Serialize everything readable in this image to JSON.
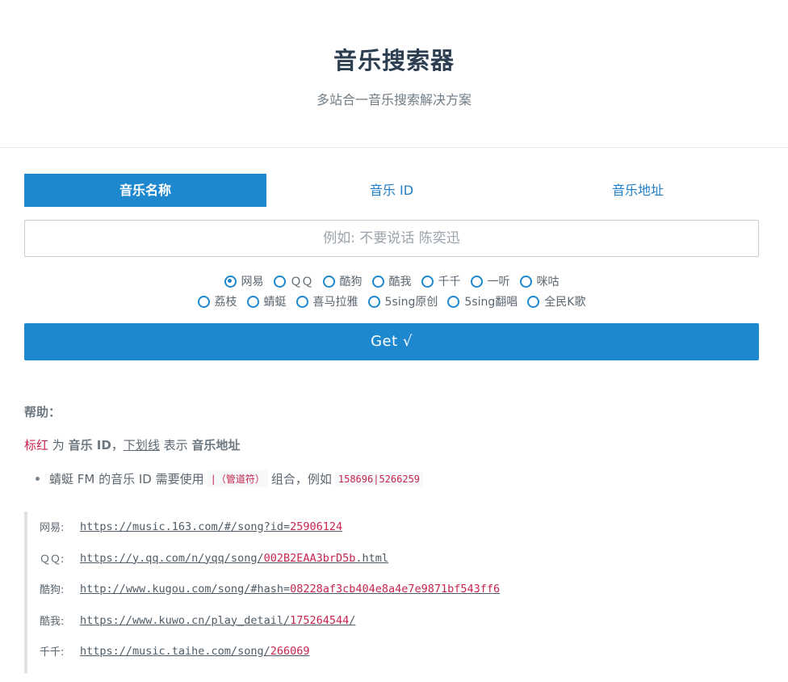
{
  "header": {
    "title": "音乐搜索器",
    "subtitle": "多站合一音乐搜索解决方案"
  },
  "tabs": [
    {
      "label": "音乐名称",
      "active": true
    },
    {
      "label": "音乐 ID",
      "active": false
    },
    {
      "label": "音乐地址",
      "active": false
    }
  ],
  "search": {
    "placeholder": "例如: 不要说话 陈奕迅",
    "value": ""
  },
  "sources": {
    "row1": [
      "网易",
      "ＱＱ",
      "酷狗",
      "酷我",
      "千千",
      "一听",
      "咪咕"
    ],
    "row2": [
      "荔枝",
      "蜻蜓",
      "喜马拉雅",
      "5sing原创",
      "5sing翻唱",
      "全民K歌"
    ],
    "selected": "网易"
  },
  "submit": {
    "label": "Get √"
  },
  "help": {
    "title": "帮助：",
    "line": {
      "red": "标红",
      "t1": " 为 ",
      "b1": "音乐 ID",
      "t2": "，",
      "underline": "下划线",
      "t3": " 表示 ",
      "b2": "音乐地址"
    },
    "bullet": {
      "t1": "蜻蜓 FM 的音乐 ID 需要使用",
      "code1": "|（管道符）",
      "t2": "组合，例如",
      "code2": "158696|5266259"
    },
    "examples": [
      {
        "label": "网易:",
        "prefix": "https://music.163.com/#/song?id=",
        "id": "25906124",
        "suffix": ""
      },
      {
        "label": "ＱＱ:",
        "prefix": "https://y.qq.com/n/yqq/song/",
        "id": "002B2EAA3brD5b",
        "suffix": ".html"
      },
      {
        "label": "酷狗:",
        "prefix": "http://www.kugou.com/song/#hash=",
        "id": "08228af3cb404e8a4e7e9871bf543ff6",
        "suffix": ""
      },
      {
        "label": "酷我:",
        "prefix": "https://www.kuwo.cn/play_detail/",
        "id": "175264544",
        "suffix": "/"
      },
      {
        "label": "千千:",
        "prefix": "https://music.taihe.com/song/",
        "id": "266069",
        "suffix": ""
      }
    ]
  }
}
